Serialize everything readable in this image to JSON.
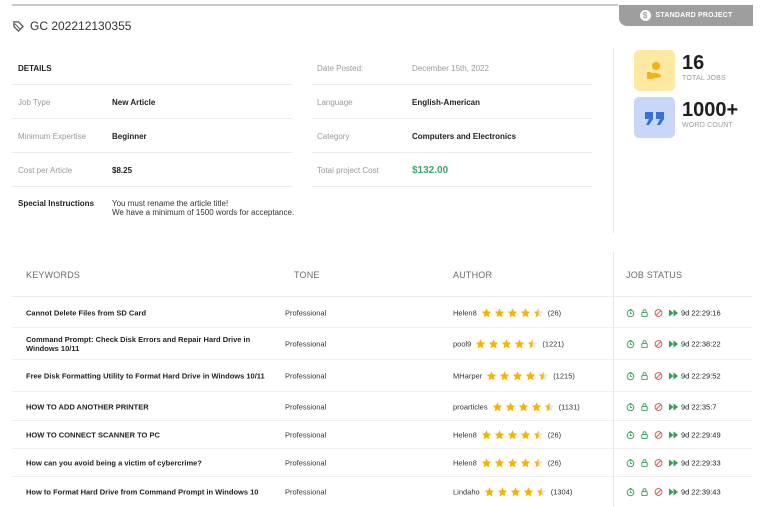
{
  "badge": {
    "label": "STANDARD PROJECT",
    "icon": "dollar-circle-icon"
  },
  "project": {
    "title": "GC 202212130355",
    "icon": "tag-icon"
  },
  "details": {
    "heading": "DETAILS",
    "date_posted_label": "Date Posted:",
    "date_posted_value": "December 15th, 2022",
    "job_type_label": "Job Type",
    "job_type_value": "New Article",
    "language_label": "Language",
    "language_value": "English-American",
    "min_expertise_label": "Minimum Expertise",
    "min_expertise_value": "Beginner",
    "category_label": "Category",
    "category_value": "Computers and Electronics",
    "cost_label": "Cost per Article",
    "cost_value": "$8.25",
    "total_cost_label": "Total project Cost",
    "total_cost_value": "$132.00",
    "instructions_label": "Special Instructions",
    "instructions_line1": "You must rename the article title!",
    "instructions_line2": "We have a minimum of 1500 words for acceptance."
  },
  "stats": {
    "jobs_value": "16",
    "jobs_label": "TOTAL JOBS",
    "words_value": "1000+",
    "words_label": "WORD COUNT"
  },
  "table": {
    "headers": {
      "keywords": "KEYWORDS",
      "tone": "TONE",
      "author": "AUTHOR",
      "status": "JOB STATUS"
    },
    "rows": [
      {
        "keyword": "Cannot Delete Files from SD Card",
        "tone": "Professional",
        "author": "Helen8",
        "rating": 4.5,
        "count": "(26)",
        "time": "9d 22:29:16"
      },
      {
        "keyword": "Command Prompt: Check Disk Errors and Repair Hard Drive in Windows 10/11",
        "tone": "Professional",
        "author": "pool9",
        "rating": 4.5,
        "count": "(1221)",
        "time": "9d 22:38:22"
      },
      {
        "keyword": "Free Disk Formatting Utility to Format Hard Drive in Windows 10/11",
        "tone": "Professional",
        "author": "MHarper",
        "rating": 4.5,
        "count": "(1215)",
        "time": "9d 22:29:52"
      },
      {
        "keyword": "HOW TO ADD ANOTHER PRINTER",
        "tone": "Professional",
        "author": "proarticles",
        "rating": 4.5,
        "count": "(1131)",
        "time": "9d 22:35:7"
      },
      {
        "keyword": "HOW TO CONNECT SCANNER TO PC",
        "tone": "Professional",
        "author": "Helen8",
        "rating": 4.5,
        "count": "(26)",
        "time": "9d 22:29:49"
      },
      {
        "keyword": "How can you avoid being a victim of cybercrime?",
        "tone": "Professional",
        "author": "Helen8",
        "rating": 4.5,
        "count": "(26)",
        "time": "9d 22:29:33"
      },
      {
        "keyword": "How to Format Hard Drive from Command Prompt in Windows 10",
        "tone": "Professional",
        "author": "Lindaho",
        "rating": 4.5,
        "count": "(1304)",
        "time": "9d 22:39:43"
      }
    ]
  },
  "colors": {
    "star": "#f5b400",
    "status_green": "#2f9e5a",
    "status_red": "#e0484d",
    "total_cost": "#3aa66a",
    "jobs_icon_bg": "#fde9a2",
    "words_icon_bg": "#c8d6f7"
  }
}
